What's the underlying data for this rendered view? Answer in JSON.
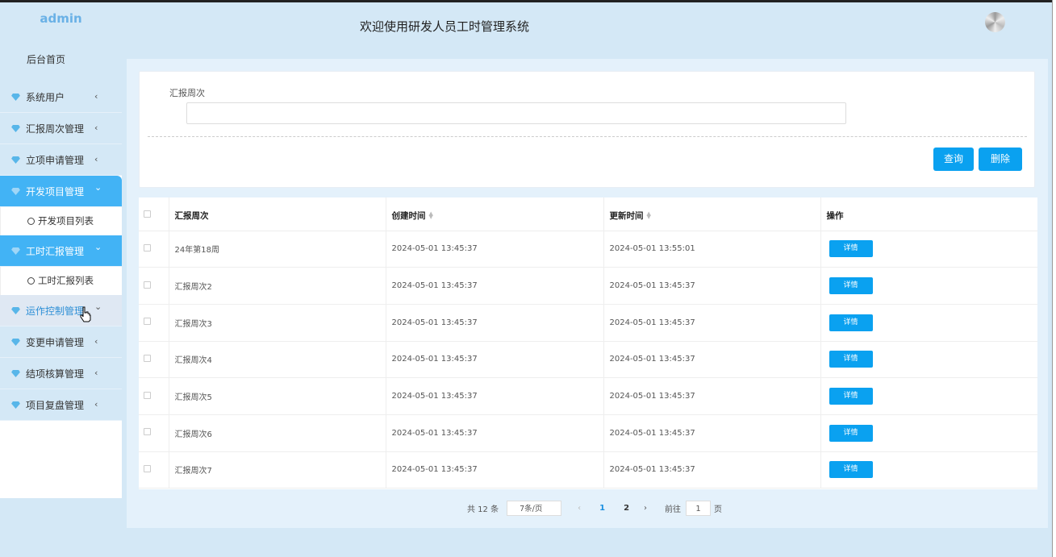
{
  "sidebar": {
    "user": "admin",
    "home": "后台首页",
    "items": [
      {
        "label": "系统用户",
        "arrow": "‹"
      },
      {
        "label": "汇报周次管理",
        "arrow": "‹"
      },
      {
        "label": "立项申请管理",
        "arrow": "‹"
      },
      {
        "label": "开发项目管理",
        "arrow": "⌄"
      },
      {
        "label": "工时汇报管理",
        "arrow": "⌄"
      },
      {
        "label": "运作控制管理",
        "arrow": "⌄"
      },
      {
        "label": "变更申请管理",
        "arrow": "‹"
      },
      {
        "label": "结项核算管理",
        "arrow": "‹"
      },
      {
        "label": "项目复盘管理",
        "arrow": "‹"
      }
    ],
    "subitems": {
      "dev": "开发项目列表",
      "work": "工时汇报列表"
    }
  },
  "header": {
    "title": "欢迎使用研发人员工时管理系统"
  },
  "search": {
    "label": "汇报周次",
    "value": "",
    "query_label": "查询",
    "delete_label": "删除"
  },
  "table": {
    "headers": {
      "week": "汇报周次",
      "created": "创建时间",
      "updated": "更新时间",
      "action": "操作"
    },
    "detail_label": "详情",
    "rows": [
      {
        "week": "24年第18周",
        "created": "2024-05-01 13:45:37",
        "updated": "2024-05-01 13:55:01"
      },
      {
        "week": "汇报周次2",
        "created": "2024-05-01 13:45:37",
        "updated": "2024-05-01 13:45:37"
      },
      {
        "week": "汇报周次3",
        "created": "2024-05-01 13:45:37",
        "updated": "2024-05-01 13:45:37"
      },
      {
        "week": "汇报周次4",
        "created": "2024-05-01 13:45:37",
        "updated": "2024-05-01 13:45:37"
      },
      {
        "week": "汇报周次5",
        "created": "2024-05-01 13:45:37",
        "updated": "2024-05-01 13:45:37"
      },
      {
        "week": "汇报周次6",
        "created": "2024-05-01 13:45:37",
        "updated": "2024-05-01 13:45:37"
      },
      {
        "week": "汇报周次7",
        "created": "2024-05-01 13:45:37",
        "updated": "2024-05-01 13:45:37"
      }
    ]
  },
  "pagination": {
    "total": "共 12 条",
    "page_size": "7条/页",
    "prev": "‹",
    "pages": [
      "1",
      "2"
    ],
    "next": "›",
    "goto_prefix": "前往",
    "goto_value": "1",
    "goto_suffix": "页"
  },
  "colors": {
    "accent": "#0aa1f0",
    "sidebar_active": "#42b3f5",
    "background": "#d4e8f6"
  }
}
